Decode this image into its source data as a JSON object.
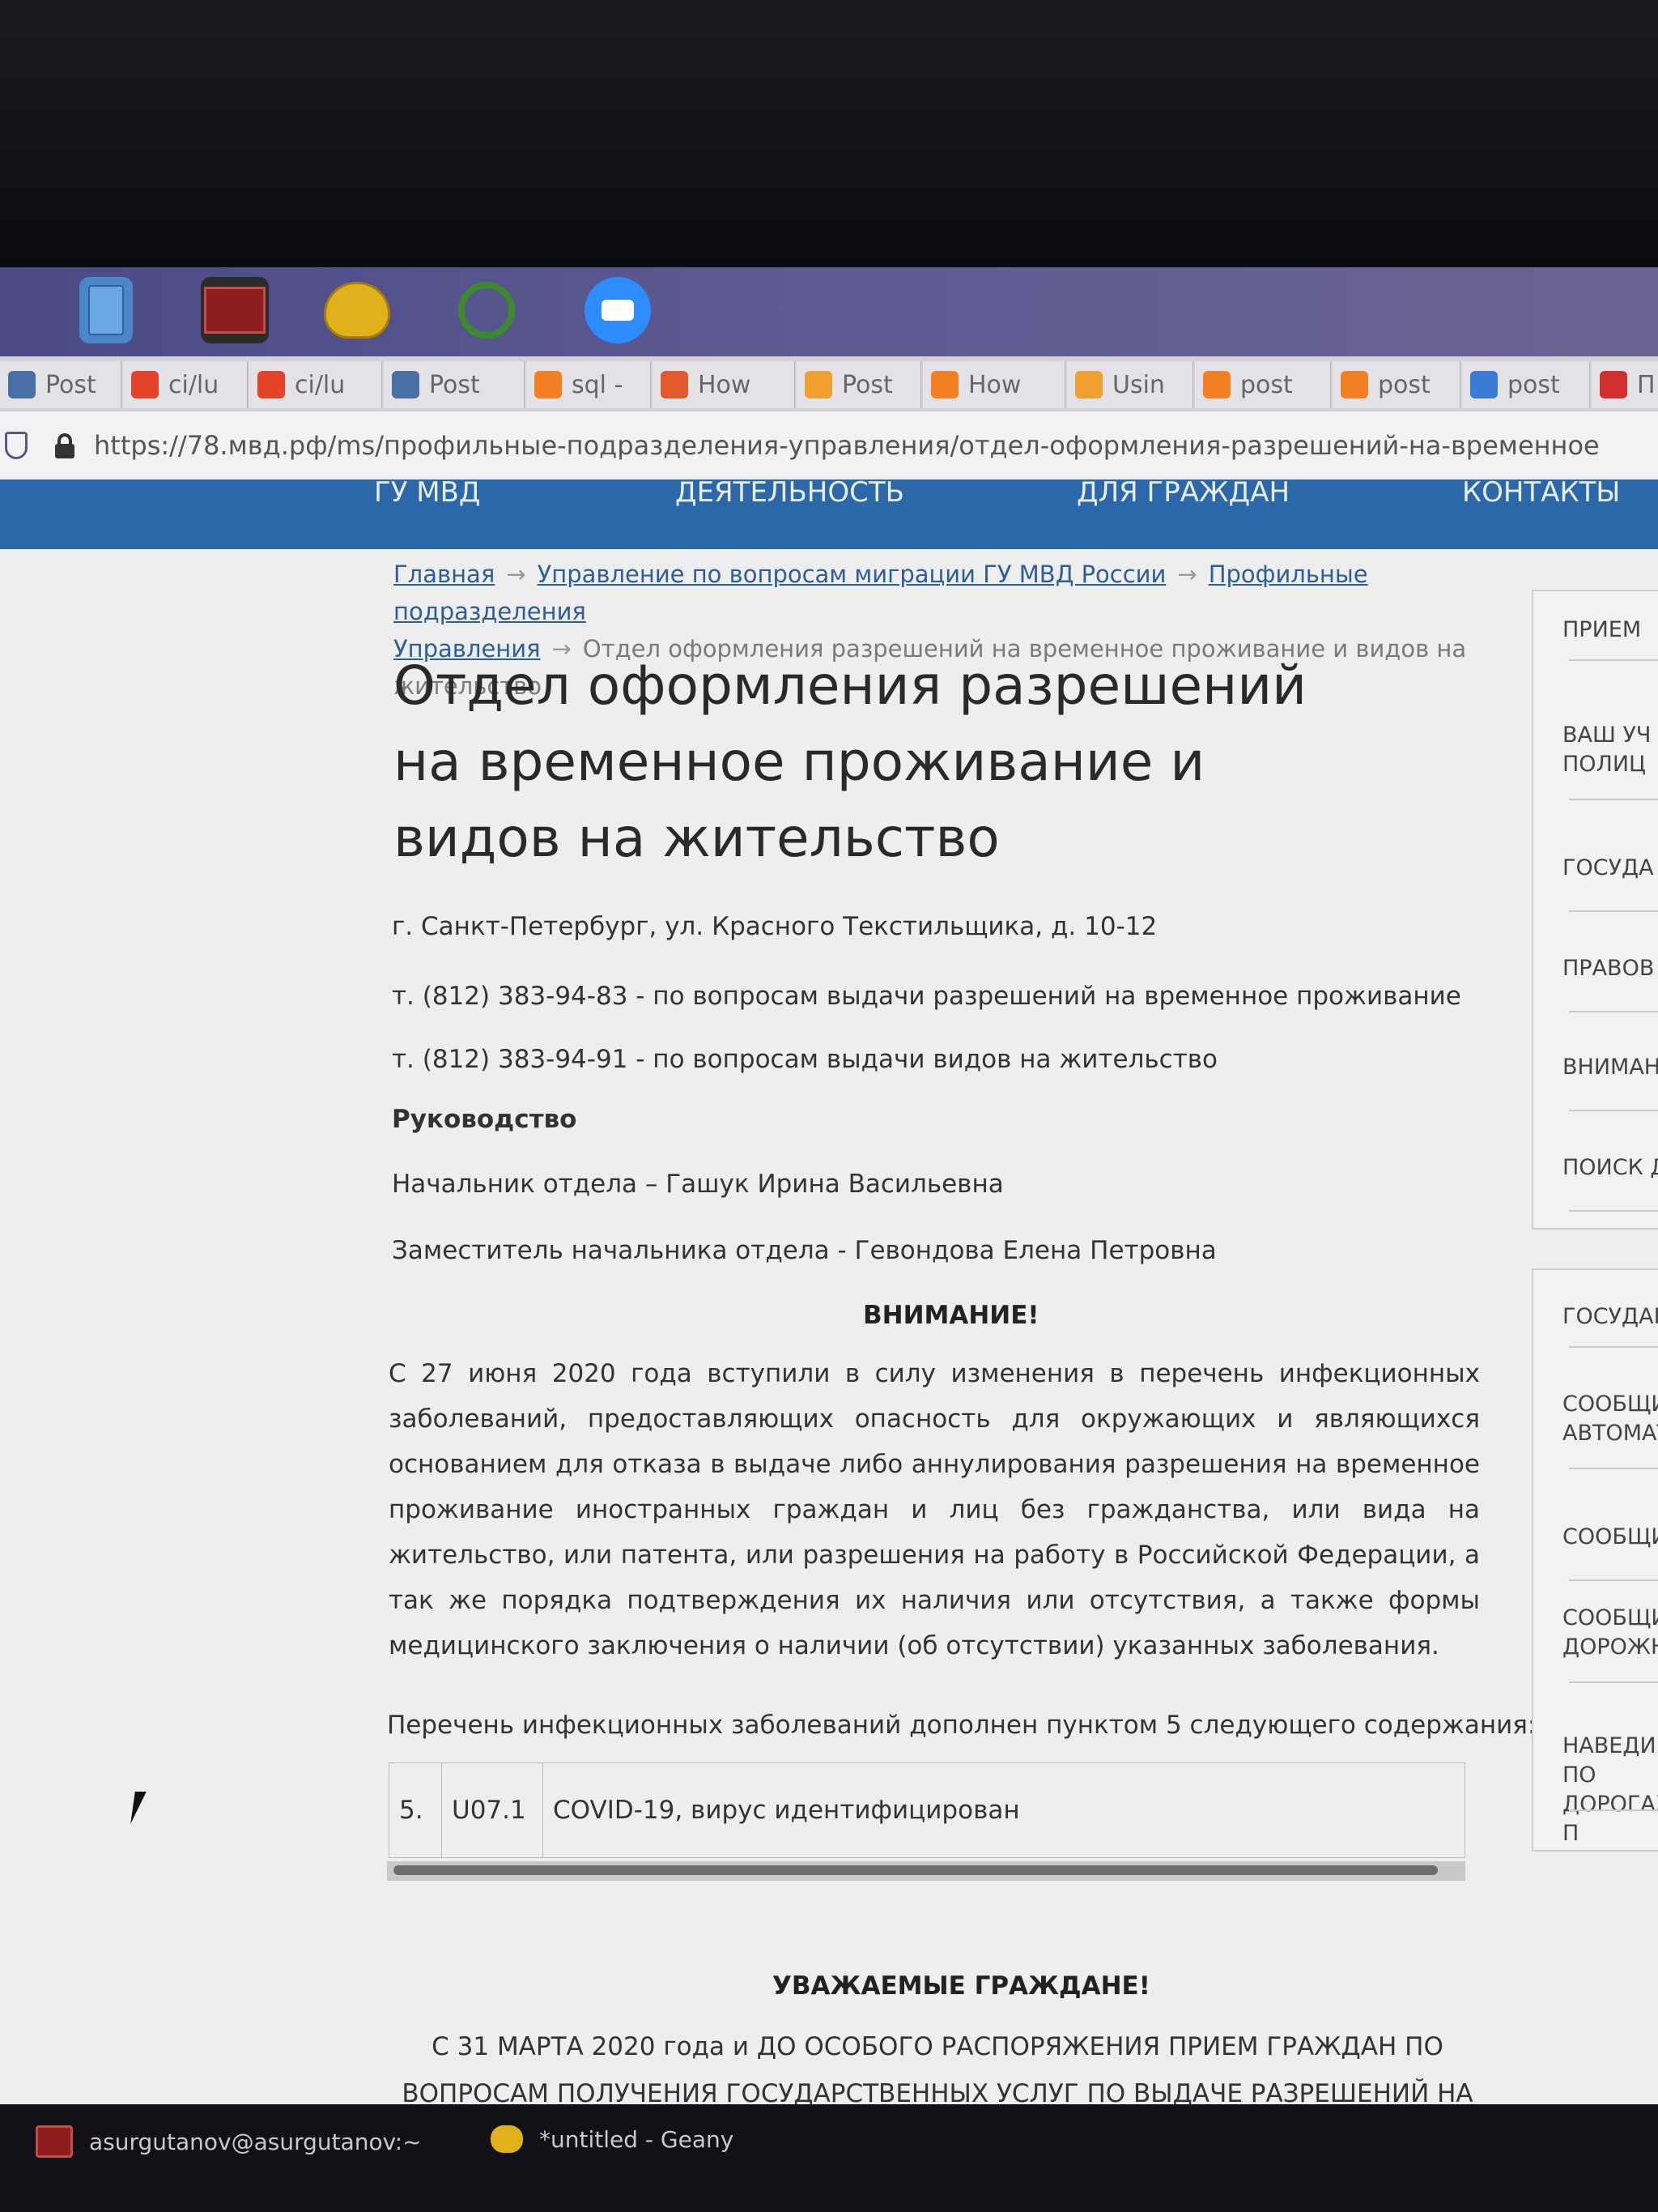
{
  "tabs": [
    {
      "label": "Post",
      "icon": "postgres-elephant-icon",
      "color": "#4a6fa5"
    },
    {
      "label": "ci/lu",
      "icon": "gitlab-icon",
      "color": "#e24329"
    },
    {
      "label": "ci/lu",
      "icon": "gitlab-icon",
      "color": "#e24329"
    },
    {
      "label": "Post",
      "icon": "postgres-elephant-icon",
      "color": "#4a6fa5"
    },
    {
      "label": "sql -",
      "icon": "stackoverflow-icon",
      "color": "#f48024"
    },
    {
      "label": "How",
      "icon": "dash-icon",
      "color": "#e05a2b"
    },
    {
      "label": "Post",
      "icon": "uc-icon",
      "color": "#f0a030"
    },
    {
      "label": "How",
      "icon": "stackoverflow-icon",
      "color": "#f48024"
    },
    {
      "label": "Usin",
      "icon": "uc-icon",
      "color": "#f0a030"
    },
    {
      "label": "post",
      "icon": "stackoverflow-icon",
      "color": "#f48024"
    },
    {
      "label": "post",
      "icon": "stackoverflow-icon",
      "color": "#f48024"
    },
    {
      "label": "post",
      "icon": "db-icon",
      "color": "#3a7bd5"
    },
    {
      "label": "П",
      "icon": "triangle-icon",
      "color": "#d03030"
    }
  ],
  "url": "https://78.мвд.рф/ms/профильные-подразделения-управления/отдел-оформления-разрешений-на-временное",
  "nav": [
    "ГУ МВД",
    "ДЕЯТЕЛЬНОСТЬ",
    "ДЛЯ ГРАЖДАН",
    "КОНТАКТЫ"
  ],
  "breadcrumbs": {
    "home": "Главная",
    "level1": "Управление по вопросам миграции ГУ МВД России",
    "level2a": "Профильные подразделения",
    "level2b": "Управления",
    "current": "Отдел оформления разрешений на временное проживание и видов на жительство",
    "arrow": "→"
  },
  "title": "Отдел оформления разрешений на временное проживание и видов на жительство",
  "address": "г. Санкт-Петербург, ул. Красного Текстильщика, д. 10-12",
  "phone1": "т. (812) 383-94-83 - по вопросам выдачи разрешений на временное проживание",
  "phone2": "т. (812) 383-94-91 - по вопросам выдачи видов на жительство",
  "leadership_heading": "Руководство",
  "head": "Начальник отдела – Гашук Ирина Васильевна",
  "deputy": "Заместитель начальника отдела - Гевондова Елена Петровна",
  "attention": "ВНИМАНИЕ!",
  "paragraph": "С 27 июня 2020 года вступили в силу изменения в перечень инфекционных заболеваний, предоставляющих опасность для окружающих и являющихся основанием для отказа в выдаче либо аннулирования разрешения на временное проживание иностранных граждан и лиц без гражданства, или вида на жительство, или патента, или разрешения на работу в Российской Федерации, а так же порядка подтверждения их наличия или отсутствия, а также формы медицинского заключения о наличии (об отсутствии) указанных заболевания.",
  "list_intro": "Перечень инфекционных заболеваний дополнен пунктом 5 следующего содержания:",
  "table": {
    "num": "5.",
    "code": "U07.1",
    "desc": "COVID-19, вирус идентифицирован"
  },
  "greeting": "УВАЖАЕМЫЕ ГРАЖДАНЕ!",
  "notice": "С 31 МАРТА 2020 года и ДО ОСОБОГО РАСПОРЯЖЕНИЯ ПРИЕМ ГРАЖДАН ПО ВОПРОСАМ ПОЛУЧЕНИЯ ГОСУДАРСТВЕННЫХ УСЛУГ ПО ВЫДАЧЕ РАЗРЕШЕНИЙ НА ВРЕМЕННОЕ",
  "sidebar_top": [
    "ПРИЕМ",
    "ВАШ УЧ\nПОЛИЦ",
    "ГОСУДА",
    "ПРАВОВ",
    "ВНИМАН",
    "ПОИСК Д"
  ],
  "sidebar_bottom": [
    "ГОСУДАР",
    "СООБЩИ,\nАВТОМАТ",
    "СООБЩИ О",
    "СООБЩИ О\nДОРОЖНО",
    "НАВЕДИ ПО\nДОРОГАХ. П"
  ],
  "taskbar": {
    "terminal": "asurgutanov@asurgutanov:~",
    "geany": "*untitled - Geany"
  }
}
